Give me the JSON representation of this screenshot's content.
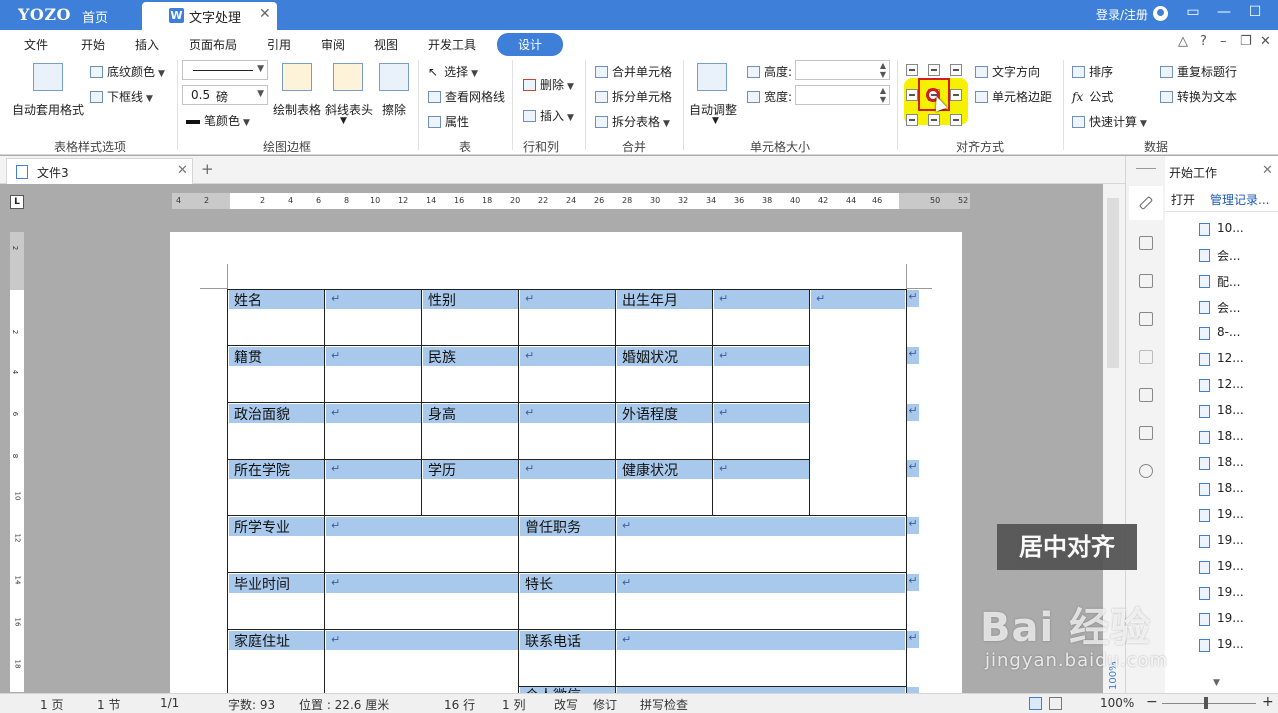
{
  "titlebar": {
    "logo": "YOZO",
    "home": "首页",
    "doc_tab_badge": "W",
    "doc_tab": "文字处理",
    "login": "登录/注册"
  },
  "menu": {
    "items": [
      "文件",
      "开始",
      "插入",
      "页面布局",
      "引用",
      "审阅",
      "视图",
      "开发工具"
    ],
    "active": "设计"
  },
  "ribbon": {
    "auto_format": "自动套用格式",
    "shading_color": "底纹颜色",
    "bottom_border": "下框线",
    "line_width": "0.5",
    "line_unit": "磅",
    "pen_color": "笔颜色",
    "draw_table": "绘制表格",
    "diagonal_header": "斜线表头",
    "eraser": "擦除",
    "select": "选择",
    "view_gridlines": "查看网格线",
    "properties": "属性",
    "delete": "删除",
    "insert": "插入",
    "merge_cells": "合并单元格",
    "split_cells": "拆分单元格",
    "split_table": "拆分表格",
    "auto_fit": "自动调整",
    "height_label": "高度:",
    "width_label": "宽度:",
    "text_direction": "文字方向",
    "cell_margin": "单元格边距",
    "sort": "排序",
    "formula_icon": "fx",
    "formula": "公式",
    "quick_calc": "快速计算",
    "repeat_header": "重复标题行",
    "to_text": "转换为文本",
    "groups": {
      "style_options": "表格样式选项",
      "draw_border": "绘图边框",
      "table": "表",
      "rows_cols": "行和列",
      "merge": "合并",
      "cell_size": "单元格大小",
      "alignment": "对齐方式",
      "data": "数据"
    }
  },
  "document": {
    "tab_name": "文件3",
    "ruler_marker": "L",
    "ruler_numbers": [
      "4",
      "2",
      "2",
      "4",
      "6",
      "8",
      "10",
      "12",
      "14",
      "16",
      "18",
      "20",
      "22",
      "24",
      "26",
      "28",
      "30",
      "32",
      "34",
      "36",
      "38",
      "40",
      "42",
      "44",
      "46",
      "50",
      "52"
    ],
    "vruler_numbers": [
      "2",
      "2",
      "4",
      "6",
      "8",
      "10",
      "12",
      "14",
      "16",
      "18"
    ],
    "table": {
      "row1": [
        "姓名",
        "性别",
        "出生年月"
      ],
      "row2": [
        "籍贯",
        "民族",
        "婚姻状况"
      ],
      "row3": [
        "政治面貌",
        "身高",
        "外语程度"
      ],
      "row4": [
        "所在学院",
        "学历",
        "健康状况"
      ],
      "row5": [
        "所学专业",
        "曾任职务"
      ],
      "row6": [
        "毕业时间",
        "特长"
      ],
      "row7": [
        "家庭住址",
        "联系电话"
      ],
      "row8_partial": "个人微信"
    },
    "mark": "↵"
  },
  "panel": {
    "title": "开始工作",
    "open": "打开",
    "manage": "管理记录...",
    "recent": [
      "10...",
      "会...",
      "配...",
      "会...",
      "8-...",
      "12...",
      "12...",
      "18...",
      "18...",
      "18...",
      "18...",
      "19...",
      "19...",
      "19...",
      "19...",
      "19...",
      "19..."
    ]
  },
  "status": {
    "page": "1 页",
    "section": "1 节",
    "page_of": "1/1",
    "word_count": "字数: 93",
    "position": "位置 : 22.6 厘米",
    "line": "16 行",
    "column": "1 列",
    "overwrite": "改写",
    "revise": "修订",
    "spell_check": "拼写检查",
    "zoom": "100%",
    "zoom_vertical": "100%"
  },
  "overlay": {
    "caption": "居中对齐",
    "watermark": "Bai 经验",
    "watermark_sub": "jingyan.baidu.com"
  }
}
